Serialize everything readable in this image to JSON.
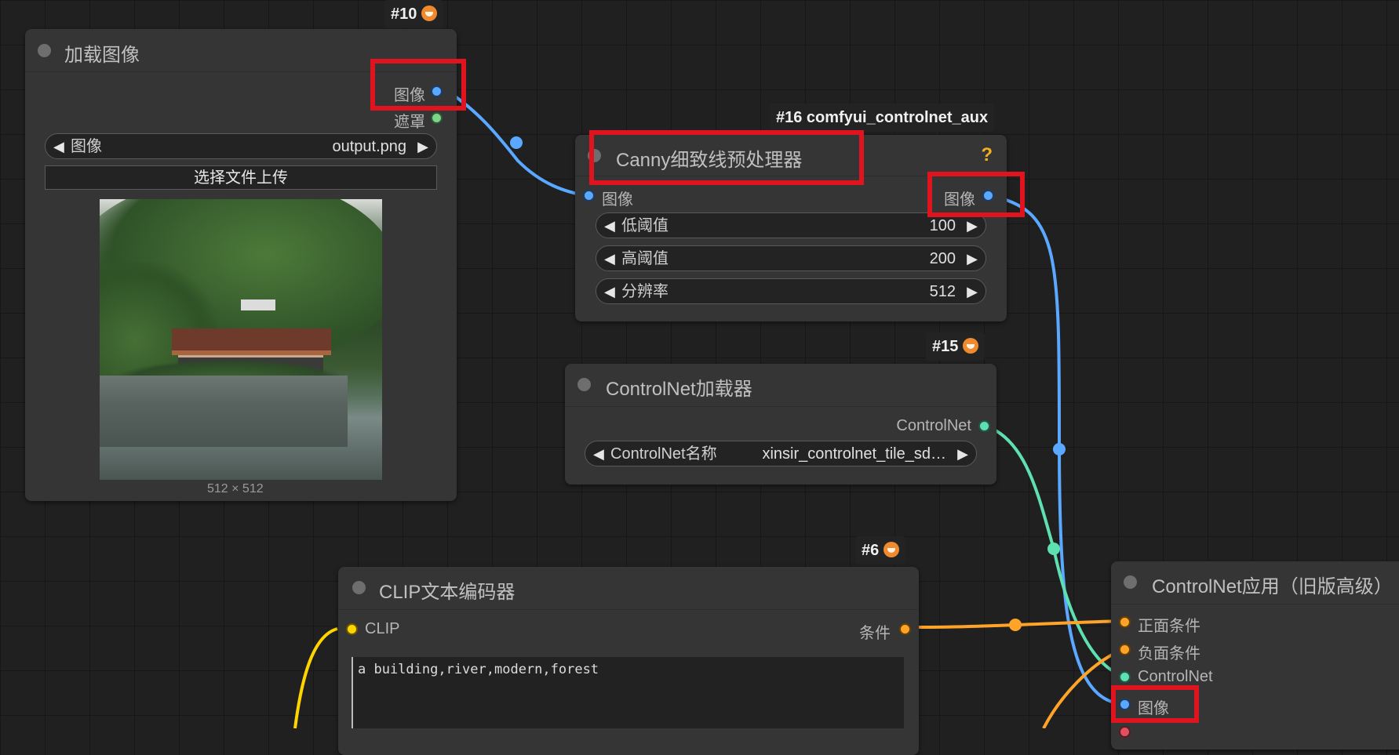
{
  "colors": {
    "image": "#5aa8ff",
    "mask": "#7fd28a",
    "controlnet": "#5fe0b0",
    "conditioning": "#ffa428",
    "clip": "#ffd500",
    "highlight": "#e0141e"
  },
  "nodes": {
    "load_image": {
      "badge": "#10",
      "title": "加载图像",
      "outputs": [
        "图像",
        "遮罩"
      ],
      "image_widget": {
        "label": "图像",
        "value": "output.png"
      },
      "upload_button": "选择文件上传",
      "image_size": "512 × 512"
    },
    "canny": {
      "badge": "#16 comfyui_controlnet_aux",
      "title": "Canny细致线预处理器",
      "help": "?",
      "input": "图像",
      "output": "图像",
      "widgets": [
        {
          "label": "低阈值",
          "value": "100"
        },
        {
          "label": "高阈值",
          "value": "200"
        },
        {
          "label": "分辨率",
          "value": "512"
        }
      ]
    },
    "controlnet_loader": {
      "badge": "#15",
      "title": "ControlNet加载器",
      "output": "ControlNet",
      "widget": {
        "label": "ControlNet名称",
        "value": "xinsir_controlnet_tile_sd…"
      }
    },
    "clip_encoder": {
      "badge": "#6",
      "title": "CLIP文本编码器",
      "input": "CLIP",
      "output": "条件",
      "text": "a building,river,modern,forest"
    },
    "controlnet_apply": {
      "title": "ControlNet应用（旧版高级）",
      "inputs": [
        "正面条件",
        "负面条件",
        "ControlNet",
        "图像"
      ]
    }
  }
}
